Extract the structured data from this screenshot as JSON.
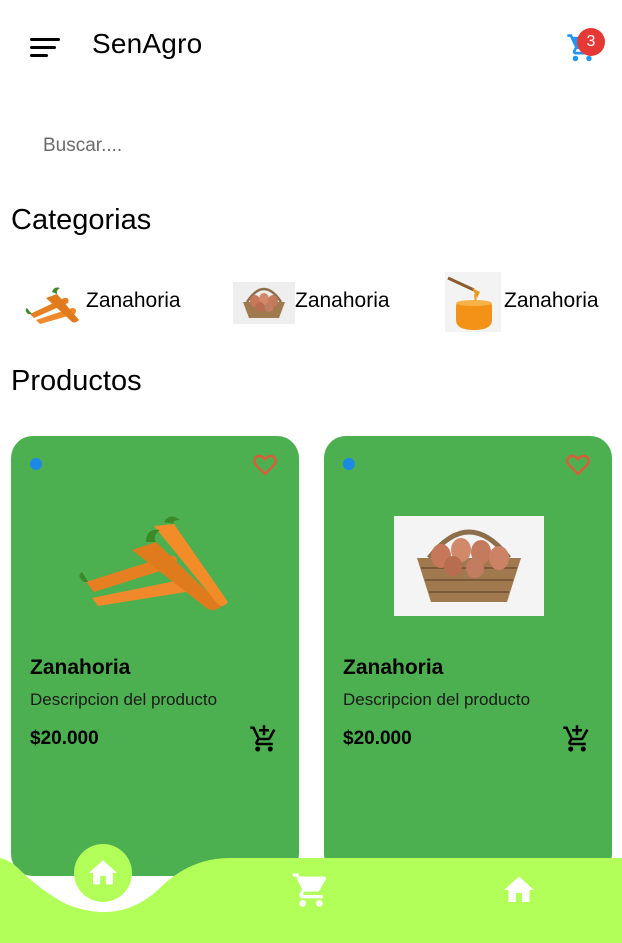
{
  "app": {
    "title": "SenAgro",
    "cart_count": "3",
    "accent_color": "#4caf50",
    "nav_color": "#b2ff59",
    "badge_color": "#e53935"
  },
  "search": {
    "placeholder": "Buscar...."
  },
  "sections": {
    "categories": "Categorias",
    "products": "Productos"
  },
  "categories": [
    {
      "label": "Zanahoria",
      "icon": "carrots-image"
    },
    {
      "label": "Zanahoria",
      "icon": "egg-basket-image"
    },
    {
      "label": "Zanahoria",
      "icon": "honey-jar-image"
    }
  ],
  "products": [
    {
      "name": "Zanahoria",
      "description": "Descripcion del producto",
      "price": "$20.000",
      "image": "carrots-image"
    },
    {
      "name": "Zanahoria",
      "description": "Descripcion del producto",
      "price": "$20.000",
      "image": "egg-basket-image"
    }
  ],
  "bottom_nav": [
    {
      "icon": "home-icon",
      "active": true
    },
    {
      "icon": "cart-icon",
      "active": false
    },
    {
      "icon": "home-icon",
      "active": false
    }
  ]
}
